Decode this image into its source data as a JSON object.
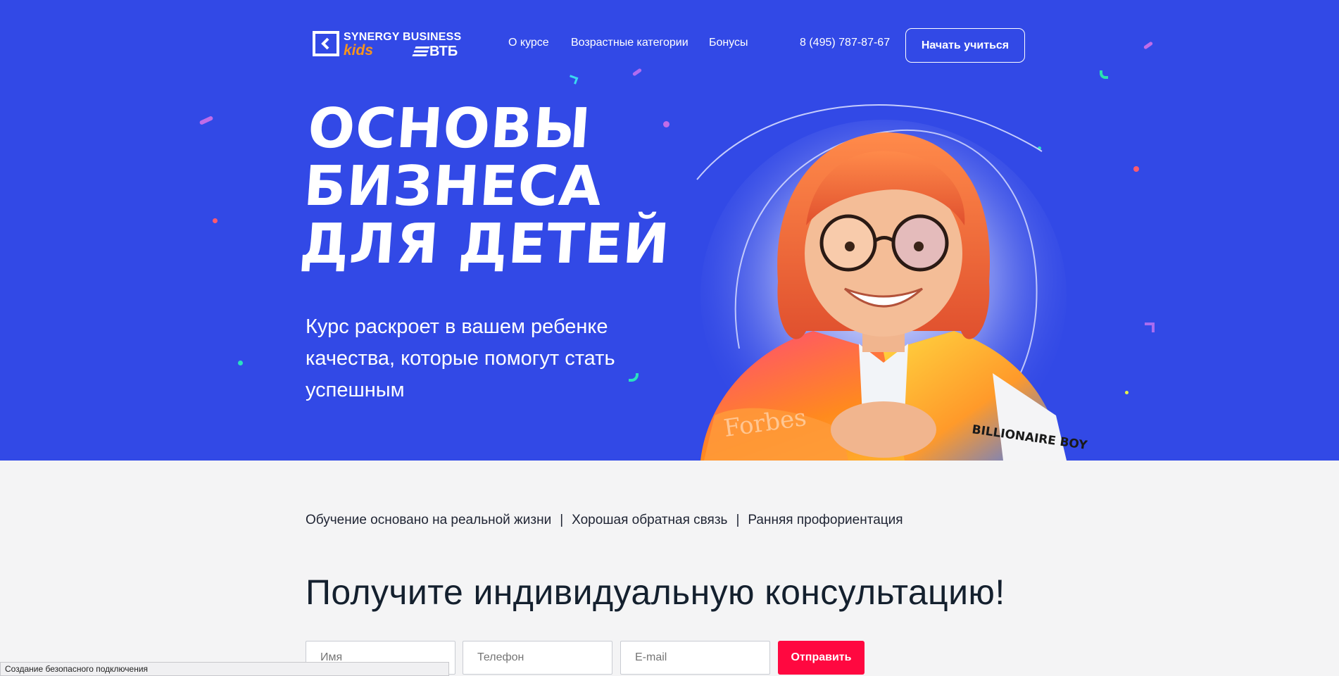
{
  "header": {
    "logo": {
      "brand_top": "SYNERGY BUSINESS",
      "brand_kids": "kids",
      "brand_partner": "ВТБ"
    },
    "nav": [
      "О курсе",
      "Возрастные категории",
      "Бонусы"
    ],
    "phone": "8 (495) 787-87-67",
    "cta_label": "Начать учиться"
  },
  "hero": {
    "title_lines": [
      "ОСНОВЫ",
      "БИЗНЕСА",
      "ДЛЯ  ДЕТЕЙ"
    ],
    "subtitle": "Курс раскроет в вашем ребенке качества, которые помогут стать успешным",
    "image": {
      "jacket_print_left": "Forbes",
      "jacket_print_right": "BILLIONAIRE BOYS CLUB"
    },
    "colors": {
      "background": "#3249e6",
      "accent_orange": "#f7941d"
    }
  },
  "features": [
    "Обучение основано на реальной жизни",
    "Хорошая обратная связь",
    "Ранняя профориентация"
  ],
  "form": {
    "title": "Получите индивидуальную консультацию!",
    "name_placeholder": "Имя",
    "phone_placeholder": "Телефон",
    "email_placeholder": "E-mail",
    "submit_label": "Отправить",
    "submit_color": "#ff0840"
  },
  "status_bar": "Создание безопасного подключения"
}
